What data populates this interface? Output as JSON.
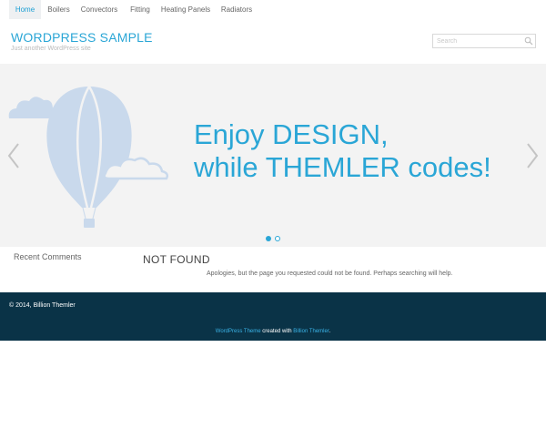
{
  "nav": {
    "items": [
      {
        "label": "Home",
        "active": true
      },
      {
        "label": "Boilers",
        "active": false
      },
      {
        "label": "Convectors",
        "active": false
      },
      {
        "label": "Fitting",
        "active": false
      },
      {
        "label": "Heating Panels",
        "active": false
      },
      {
        "label": "Radiators",
        "active": false
      }
    ]
  },
  "header": {
    "title": "WORDPRESS SAMPLE",
    "tagline": "Just another WordPress site"
  },
  "search": {
    "placeholder": "Search",
    "icon": "search-icon"
  },
  "slider": {
    "line1": "Enjoy DESIGN,",
    "line2": "while THEMLER codes!",
    "prev_icon": "chevron-left-icon",
    "next_icon": "chevron-right-icon",
    "slide_count": 2,
    "active_slide": 1,
    "image": "balloon-illustration"
  },
  "sidebar": {
    "title": "Recent Comments"
  },
  "main": {
    "title": "NOT FOUND",
    "message": "Apologies, but the page you requested could not be found. Perhaps searching will help."
  },
  "footer": {
    "copyright": "© 2014, Billion Themler",
    "credit_link1": "WordPress Theme",
    "credit_middle": " created with ",
    "credit_link2": "Billion Themler",
    "credit_end": "."
  },
  "colors": {
    "accent": "#2aa6d6",
    "footer_bg": "#0a3347",
    "slider_bg": "#f3f3f3",
    "illustration": "#c9d9ec"
  }
}
